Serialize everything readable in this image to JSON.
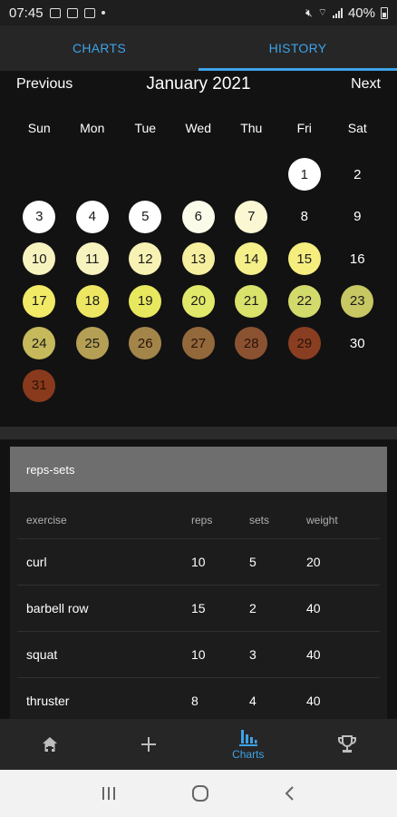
{
  "status_bar": {
    "time": "07:45",
    "battery": "40%"
  },
  "tabs": [
    {
      "label": "CHARTS",
      "active": false
    },
    {
      "label": "HISTORY",
      "active": true
    }
  ],
  "calendar": {
    "prev_label": "Previous",
    "month_label": "January 2021",
    "next_label": "Next",
    "weekdays": [
      "Sun",
      "Mon",
      "Tue",
      "Wed",
      "Thu",
      "Fri",
      "Sat"
    ],
    "first_weekday_index": 5,
    "days": [
      {
        "day": "1",
        "color": "#ffffff"
      },
      {
        "day": "2",
        "color": ""
      },
      {
        "day": "3",
        "color": "#ffffff"
      },
      {
        "day": "4",
        "color": "#ffffff"
      },
      {
        "day": "5",
        "color": "#ffffff"
      },
      {
        "day": "6",
        "color": "#fbfbe9"
      },
      {
        "day": "7",
        "color": "#fbf7d3"
      },
      {
        "day": "8",
        "color": ""
      },
      {
        "day": "9",
        "color": ""
      },
      {
        "day": "10",
        "color": "#f7f3bf"
      },
      {
        "day": "11",
        "color": "#f7f3bf"
      },
      {
        "day": "12",
        "color": "#f7f1b3"
      },
      {
        "day": "13",
        "color": "#f6ef9f"
      },
      {
        "day": "14",
        "color": "#f5ef8a"
      },
      {
        "day": "15",
        "color": "#f5ee7f"
      },
      {
        "day": "16",
        "color": ""
      },
      {
        "day": "17",
        "color": "#f1ea67"
      },
      {
        "day": "18",
        "color": "#ede663"
      },
      {
        "day": "19",
        "color": "#e8e85f"
      },
      {
        "day": "20",
        "color": "#e1e96a"
      },
      {
        "day": "21",
        "color": "#d9e26a"
      },
      {
        "day": "22",
        "color": "#d3da6c"
      },
      {
        "day": "23",
        "color": "#c7c763"
      },
      {
        "day": "24",
        "color": "#c5b95c"
      },
      {
        "day": "25",
        "color": "#b59f54"
      },
      {
        "day": "26",
        "color": "#a3854a"
      },
      {
        "day": "27",
        "color": "#93683b"
      },
      {
        "day": "28",
        "color": "#8b5232"
      },
      {
        "day": "29",
        "color": "#8a3e21"
      },
      {
        "day": "30",
        "color": ""
      },
      {
        "day": "31",
        "color": "#8a3a1c"
      }
    ]
  },
  "workout_card": {
    "title": "reps-sets",
    "columns": [
      "exercise",
      "reps",
      "sets",
      "weight"
    ],
    "rows": [
      {
        "exercise": "curl",
        "reps": "10",
        "sets": "5",
        "weight": "20"
      },
      {
        "exercise": "barbell row",
        "reps": "15",
        "sets": "2",
        "weight": "40"
      },
      {
        "exercise": "squat",
        "reps": "10",
        "sets": "3",
        "weight": "40"
      },
      {
        "exercise": "thruster",
        "reps": "8",
        "sets": "4",
        "weight": "40"
      }
    ]
  },
  "bottom_nav": {
    "items": [
      {
        "icon": "home-icon"
      },
      {
        "icon": "plus-icon"
      },
      {
        "icon": "bar-chart-icon",
        "label": "Charts",
        "active": true
      },
      {
        "icon": "trophy-icon"
      }
    ]
  },
  "system_nav": {
    "icons": [
      "recent-apps-icon",
      "home-circle-icon",
      "back-icon"
    ]
  },
  "colors": {
    "accent": "#3ea3e8",
    "background": "#121212",
    "card_header": "#6e6e6e"
  }
}
